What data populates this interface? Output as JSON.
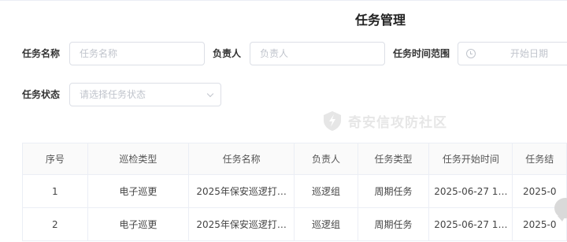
{
  "page": {
    "title": "任务管理"
  },
  "filters": {
    "task_name": {
      "label": "任务名称",
      "placeholder": "任务名称"
    },
    "owner": {
      "label": "负责人",
      "placeholder": "负责人"
    },
    "time_range": {
      "label": "任务时间范围",
      "start_placeholder": "开始日期",
      "icon": "clock-icon"
    },
    "status": {
      "label": "任务状态",
      "placeholder": "请选择任务状态",
      "icon": "chevron-down-icon"
    }
  },
  "watermark": {
    "text": "奇安信攻防社区"
  },
  "table": {
    "headers": [
      "序号",
      "巡检类型",
      "任务名称",
      "负责人",
      "任务类型",
      "任务开始时间",
      "任务结"
    ],
    "rows": [
      [
        "1",
        "电子巡更",
        "2025年保安巡逻打…",
        "巡逻组",
        "周期任务",
        "2025-06-27 1…",
        "2025-0"
      ],
      [
        "2",
        "电子巡更",
        "2025年保安巡逻打…",
        "巡逻组",
        "周期任务",
        "2025-06-27 1…",
        "2025-0"
      ]
    ]
  },
  "colors": {
    "border": "#dcdfe6",
    "placeholder": "#c0c4cc",
    "header_bg": "#fafafa"
  }
}
